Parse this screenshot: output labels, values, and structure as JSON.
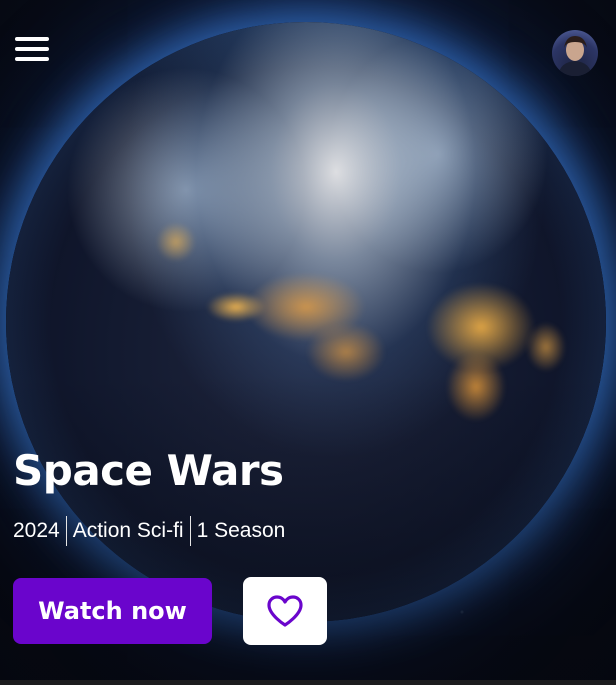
{
  "header": {
    "menu_icon": "hamburger-menu-icon",
    "avatar_icon": "user-avatar"
  },
  "hero": {
    "title": "Space Wars",
    "meta": [
      "2024",
      "Action Sci-fi",
      "1 Season"
    ],
    "watch_label": "Watch now",
    "favorite_icon": "heart-outline-icon"
  },
  "colors": {
    "accent": "#6a05cc",
    "background": "#0a0f1c",
    "text": "#ffffff"
  }
}
